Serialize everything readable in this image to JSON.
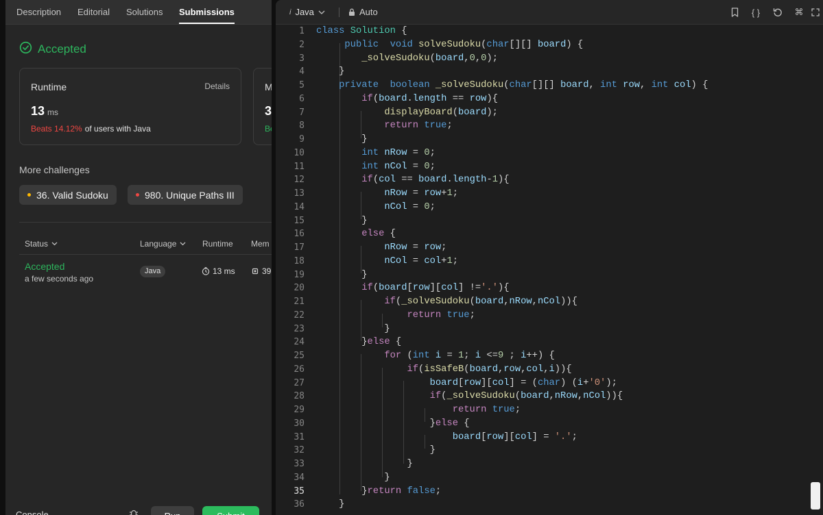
{
  "tabs": [
    {
      "label": "Description",
      "active": false
    },
    {
      "label": "Editorial",
      "active": false
    },
    {
      "label": "Solutions",
      "active": false
    },
    {
      "label": "Submissions",
      "active": true
    }
  ],
  "result": {
    "status": "Accepted",
    "status_color": "#2db55d"
  },
  "runtime_card": {
    "label": "Runtime",
    "link": "Details",
    "value": "13",
    "unit": "ms",
    "beats": "Beats 14.12%",
    "beats_suffix": "of users with Java"
  },
  "memory_card": {
    "label_visible": "M",
    "value_visible": "3",
    "beats_visible": "Be"
  },
  "more_challenges": {
    "title": "More challenges",
    "items": [
      {
        "label": "36. Valid Sudoku",
        "dot_color": "#ffb800"
      },
      {
        "label": "980. Unique Paths III",
        "dot_color": "#ef4743"
      }
    ]
  },
  "table": {
    "headers": [
      "Status",
      "Language",
      "Runtime",
      "Mem"
    ],
    "rows": [
      {
        "status": "Accepted",
        "time": "a few seconds ago",
        "language": "Java",
        "runtime": "13 ms",
        "memory": "39"
      }
    ]
  },
  "console": {
    "label": "Console",
    "run": "Run",
    "submit": "Submit"
  },
  "editor": {
    "language": "Java",
    "mode": "Auto",
    "current_line": 35,
    "line_numbers": [
      "1",
      "2",
      "3",
      "4",
      "5",
      "6",
      "7",
      "8",
      "9",
      "10",
      "11",
      "12",
      "13",
      "14",
      "15",
      "16",
      "17",
      "18",
      "19",
      "20",
      "21",
      "22",
      "23",
      "24",
      "25",
      "26",
      "27",
      "28",
      "29",
      "30",
      "31",
      "32",
      "33",
      "34",
      "35",
      "36"
    ],
    "lines": [
      "class Solution {",
      "     public  void solveSudoku(char[][] board) {",
      "        _solveSudoku(board,0,0);",
      "    }",
      "    private  boolean _solveSudoku(char[][] board, int row, int col) {",
      "        if(board.length == row){",
      "            displayBoard(board);",
      "            return true;",
      "        }",
      "        int nRow = 0;",
      "        int nCol = 0;",
      "        if(col == board.length-1){",
      "            nRow = row+1;",
      "            nCol = 0;",
      "        }",
      "        else {",
      "            nRow = row;",
      "            nCol = col+1;",
      "        }",
      "        if(board[row][col] !='.'){",
      "            if(_solveSudoku(board,nRow,nCol)){",
      "                return true;",
      "            }",
      "        }else {",
      "            for (int i = 1; i <=9 ; i++) {",
      "                if(isSafeB(board,row,col,i)){",
      "                    board[row][col] = (char) (i+'0');",
      "                    if(_solveSudoku(board,nRow,nCol)){",
      "                        return true;",
      "                    }else {",
      "                        board[row][col] = '.';",
      "                    }",
      "                }",
      "            }",
      "        }return false;",
      "    }"
    ]
  }
}
